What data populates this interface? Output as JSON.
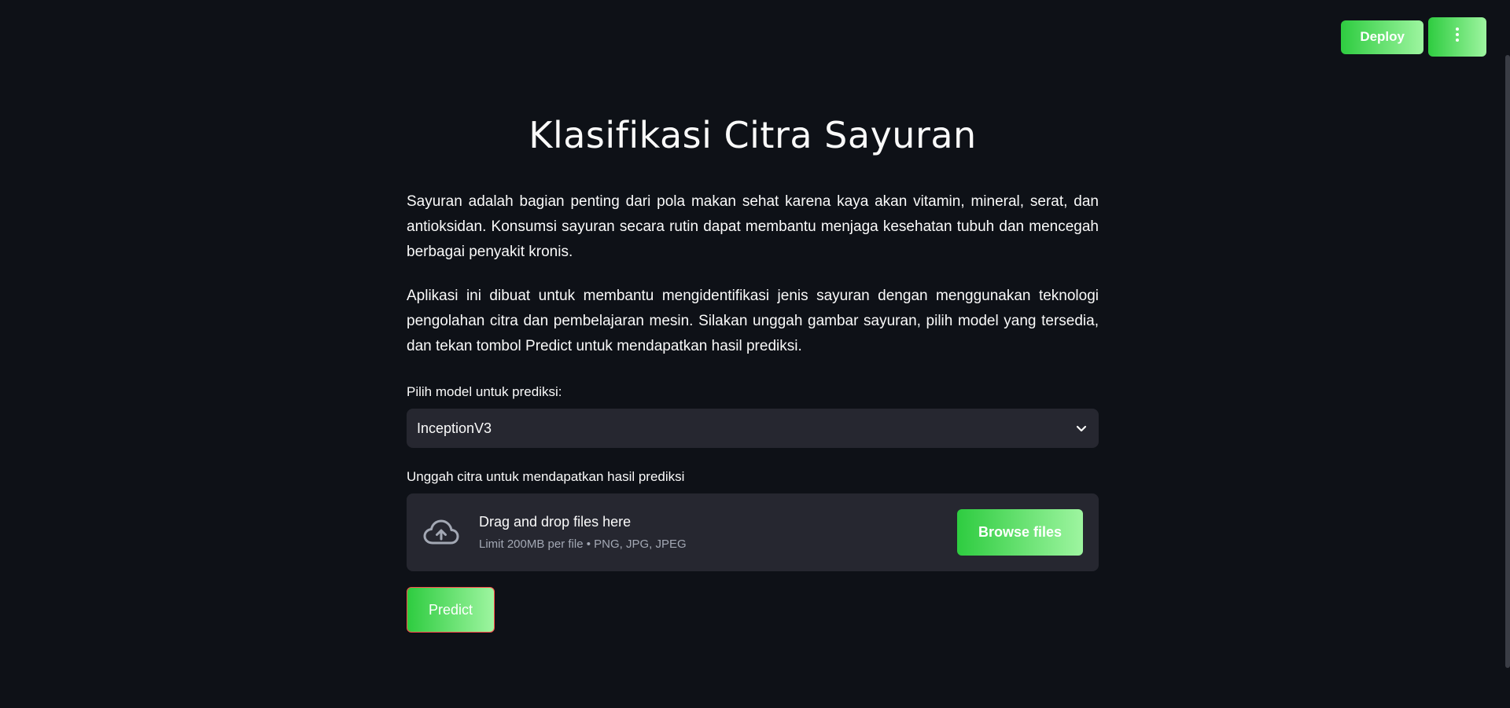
{
  "header": {
    "deploy_label": "Deploy",
    "menu_icon": "more-vertical-icon"
  },
  "main": {
    "title": "Klasifikasi Citra Sayuran",
    "paragraphs": [
      "Sayuran adalah bagian penting dari pola makan sehat karena kaya akan vitamin, mineral, serat, dan antioksidan. Konsumsi sayuran secara rutin dapat membantu menjaga kesehatan tubuh dan mencegah berbagai penyakit kronis.",
      "Aplikasi ini dibuat untuk membantu mengidentifikasi jenis sayuran dengan menggunakan teknologi pengolahan citra dan pembelajaran mesin. Silakan unggah gambar sayuran, pilih model yang tersedia, dan tekan tombol Predict untuk mendapatkan hasil prediksi."
    ],
    "model_select": {
      "label": "Pilih model untuk prediksi:",
      "value": "InceptionV3"
    },
    "uploader": {
      "label": "Unggah citra untuk mendapatkan hasil prediksi",
      "title": "Drag and drop files here",
      "limit": "Limit 200MB per file • PNG, JPG, JPEG",
      "browse_label": "Browse files",
      "icon": "cloud-upload-icon"
    },
    "predict_label": "Predict"
  },
  "colors": {
    "background": "#0e1117",
    "panel": "#262730",
    "button_gradient_start": "#2ecc40",
    "button_gradient_end": "#9ef5a0",
    "predict_border": "#ff4b4b",
    "muted_text": "#a3a8b4"
  }
}
